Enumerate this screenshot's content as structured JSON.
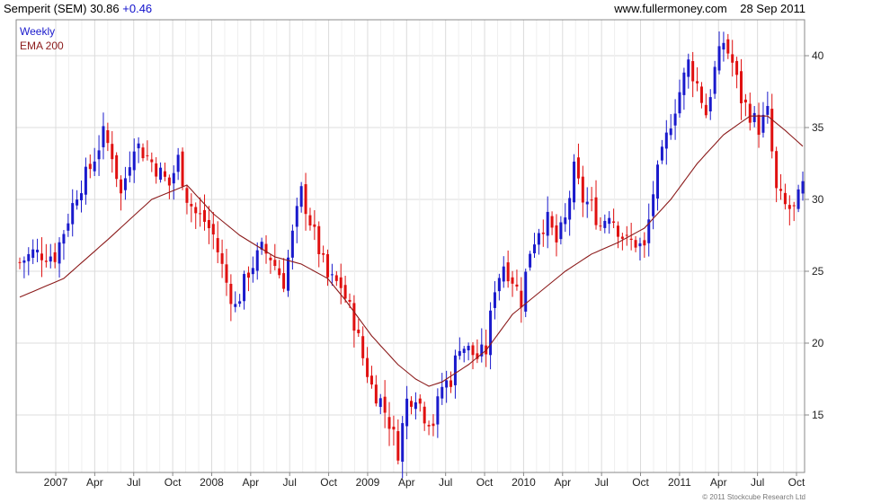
{
  "header": {
    "title": "Semperit (SEM)",
    "last": "30.86",
    "change": "+0.46",
    "site": "www.fullermoney.com",
    "date": "28 Sep 2011"
  },
  "legend": {
    "interval": "Weekly",
    "ema": "EMA 200"
  },
  "copyright": "© 2011 Stockcube Research Ltd",
  "colors": {
    "up": "#1a1acc",
    "down": "#e01010",
    "ema": "#8b1a1a",
    "grid": "#dcdcdc"
  },
  "chart_data": {
    "type": "candlestick",
    "x_ticks": [
      "2007",
      "Apr",
      "Jul",
      "Oct",
      "2008",
      "Apr",
      "Jul",
      "Oct",
      "2009",
      "Apr",
      "Jul",
      "Oct",
      "2010",
      "Apr",
      "Jul",
      "Oct",
      "2011",
      "Apr",
      "Jul",
      "Oct"
    ],
    "y_ticks": [
      15,
      20,
      25,
      30,
      35,
      40
    ],
    "ylim": [
      11,
      42.5
    ],
    "grid": true,
    "legend_position": "top-left",
    "price_path": [
      [
        0,
        25.6
      ],
      [
        3,
        26.3
      ],
      [
        8,
        26.1
      ],
      [
        10,
        27.8
      ],
      [
        13,
        30.5
      ],
      [
        16,
        32.2
      ],
      [
        19,
        34.5
      ],
      [
        21,
        33.2
      ],
      [
        23,
        30.3
      ],
      [
        26,
        34.0
      ],
      [
        29,
        33.0
      ],
      [
        31,
        32.2
      ],
      [
        34,
        31.0
      ],
      [
        36,
        32.8
      ],
      [
        38,
        30.2
      ],
      [
        40,
        29.0
      ],
      [
        42,
        28.5
      ],
      [
        44,
        27.5
      ],
      [
        47,
        24.2
      ],
      [
        49,
        22.5
      ],
      [
        52,
        25.0
      ],
      [
        55,
        26.5
      ],
      [
        57,
        26.0
      ],
      [
        60,
        24.3
      ],
      [
        62,
        27.5
      ],
      [
        64,
        30.5
      ],
      [
        67,
        27.5
      ],
      [
        70,
        24.5
      ],
      [
        73,
        24.0
      ],
      [
        76,
        21.5
      ],
      [
        78,
        19.0
      ],
      [
        80,
        17.0
      ],
      [
        82,
        16.0
      ],
      [
        84,
        14.5
      ],
      [
        86,
        12.5
      ],
      [
        88,
        16.0
      ],
      [
        90,
        16.5
      ],
      [
        92,
        15.0
      ],
      [
        94,
        14.5
      ],
      [
        96,
        17.0
      ],
      [
        98,
        17.5
      ],
      [
        100,
        20.0
      ],
      [
        102,
        19.5
      ],
      [
        104,
        19.0
      ],
      [
        106,
        19.5
      ],
      [
        108,
        24.0
      ],
      [
        110,
        25.5
      ],
      [
        112,
        24.5
      ],
      [
        114,
        23.0
      ],
      [
        116,
        26.5
      ],
      [
        118,
        28.0
      ],
      [
        120,
        28.5
      ],
      [
        122,
        27.0
      ],
      [
        124,
        28.5
      ],
      [
        126,
        32.0
      ],
      [
        128,
        30.0
      ],
      [
        130,
        29.5
      ],
      [
        132,
        28.2
      ],
      [
        134,
        29.2
      ],
      [
        136,
        28.0
      ],
      [
        138,
        27.0
      ],
      [
        140,
        27.0
      ],
      [
        142,
        26.5
      ],
      [
        144,
        30.5
      ],
      [
        146,
        33.0
      ],
      [
        148,
        35.5
      ],
      [
        150,
        37.5
      ],
      [
        152,
        39.5
      ],
      [
        154,
        38.0
      ],
      [
        156,
        36.0
      ],
      [
        158,
        39.0
      ],
      [
        160,
        41.0
      ],
      [
        162,
        39.5
      ],
      [
        164,
        37.0
      ],
      [
        166,
        36.0
      ],
      [
        168,
        35.0
      ],
      [
        170,
        36.0
      ],
      [
        172,
        30.5
      ],
      [
        174,
        29.5
      ],
      [
        176,
        29.2
      ],
      [
        178,
        30.86
      ]
    ],
    "ema_path": [
      [
        0,
        23.2
      ],
      [
        10,
        24.5
      ],
      [
        20,
        27.2
      ],
      [
        30,
        30.0
      ],
      [
        38,
        31.0
      ],
      [
        44,
        29.0
      ],
      [
        50,
        27.5
      ],
      [
        58,
        26.0
      ],
      [
        64,
        25.5
      ],
      [
        70,
        24.5
      ],
      [
        74,
        23.0
      ],
      [
        80,
        20.5
      ],
      [
        86,
        18.5
      ],
      [
        90,
        17.5
      ],
      [
        93,
        17.0
      ],
      [
        96,
        17.3
      ],
      [
        102,
        18.5
      ],
      [
        106,
        19.5
      ],
      [
        112,
        22.0
      ],
      [
        118,
        23.5
      ],
      [
        124,
        25.0
      ],
      [
        130,
        26.2
      ],
      [
        136,
        27.0
      ],
      [
        142,
        28.0
      ],
      [
        148,
        30.0
      ],
      [
        154,
        32.5
      ],
      [
        160,
        34.5
      ],
      [
        166,
        35.8
      ],
      [
        170,
        35.8
      ],
      [
        174,
        34.8
      ],
      [
        178,
        33.7
      ]
    ]
  }
}
